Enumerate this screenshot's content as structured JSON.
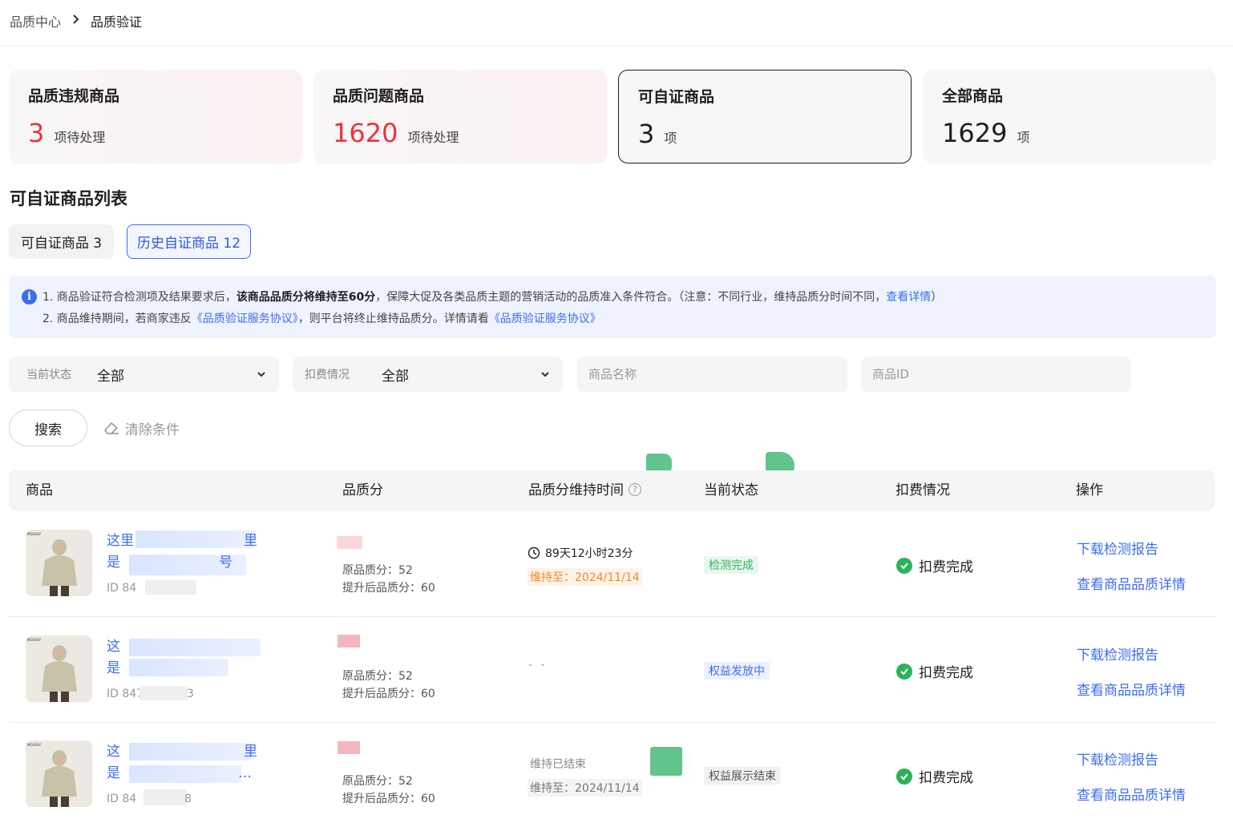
{
  "breadcrumb": {
    "parent": "品质中心",
    "separator": ">",
    "current": "品质验证"
  },
  "cards": [
    {
      "title": "品质违规商品",
      "count": "3",
      "unit": "项待处理"
    },
    {
      "title": "品质问题商品",
      "count": "1620",
      "unit": "项待处理"
    },
    {
      "title": "可自证商品",
      "count": "3",
      "unit": "项"
    },
    {
      "title": "全部商品",
      "count": "1629",
      "unit": "项"
    }
  ],
  "section_title": "可自证商品列表",
  "tabs": [
    {
      "label": "可自证商品 3"
    },
    {
      "label": "历史自证商品 12"
    }
  ],
  "notice": {
    "line1_prefix": "1.  商品验证符合检测项及结果要求后，",
    "line1_bold": "该商品品质分将维持至60分",
    "line1_suffix": "，保障大促及各类品质主题的营销活动的品质准入条件符合。（注意：不同行业，维持品质分时间不同，",
    "line1_link": "查看详情",
    "line1_end": "）",
    "line2_prefix": "2.  商品维持期间，若商家违反",
    "line2_link1": "《品质验证服务协议》",
    "line2_mid": "，则平台将终止维持品质分。详情请看",
    "line2_link2": "《品质验证服务协议》"
  },
  "filters": {
    "status_label": "当前状态",
    "status_value": "全部",
    "fee_label": "扣费情况",
    "fee_value": "全部",
    "name_placeholder": "商品名称",
    "id_placeholder": "商品ID"
  },
  "buttons": {
    "search": "搜索",
    "clear": "清除条件"
  },
  "table": {
    "headers": {
      "product": "商品",
      "score": "品质分",
      "keep_time": "品质分维持时间",
      "help": "?",
      "status": "当前状态",
      "fee": "扣费情况",
      "ops": "操作"
    },
    "rows": [
      {
        "name_line1": "这里",
        "name_tail1": "里",
        "name_line2": "是",
        "name_tail2": "号",
        "id": "ID 84",
        "original_score": "原品质分：52",
        "improved_score": "提升后品质分：60",
        "countdown": "89天12小时23分",
        "until": "维持至：2024/11/14",
        "status": "检测完成",
        "fee": "扣费完成",
        "op1": "下载检测报告",
        "op2": "查看商品品质详情"
      },
      {
        "name_line1": "这",
        "name_line2": "是",
        "id": "ID 847",
        "id_tail": "3",
        "original_score": "原品质分：52",
        "improved_score": "提升后品质分：60",
        "keep_empty": "- -",
        "status": "权益发放中",
        "fee": "扣费完成",
        "op1": "下载检测报告",
        "op2": "查看商品品质详情"
      },
      {
        "name_line1": "这",
        "name_tail1": "里",
        "name_line2": "是",
        "name_tail2": "…",
        "id": "ID 84",
        "id_tail": "8",
        "original_score": "原品质分：52",
        "improved_score": "提升后品质分：60",
        "ended": "维持已结束",
        "until": "维持至：2024/11/14",
        "status": "权益展示结束",
        "fee": "扣费完成",
        "op1": "下载检测报告",
        "op2": "查看商品品质详情"
      }
    ]
  },
  "colors": {
    "accent": "#3d6df0",
    "danger": "#e8343c",
    "success": "#2bb35a",
    "warning": "#f08a2a"
  }
}
